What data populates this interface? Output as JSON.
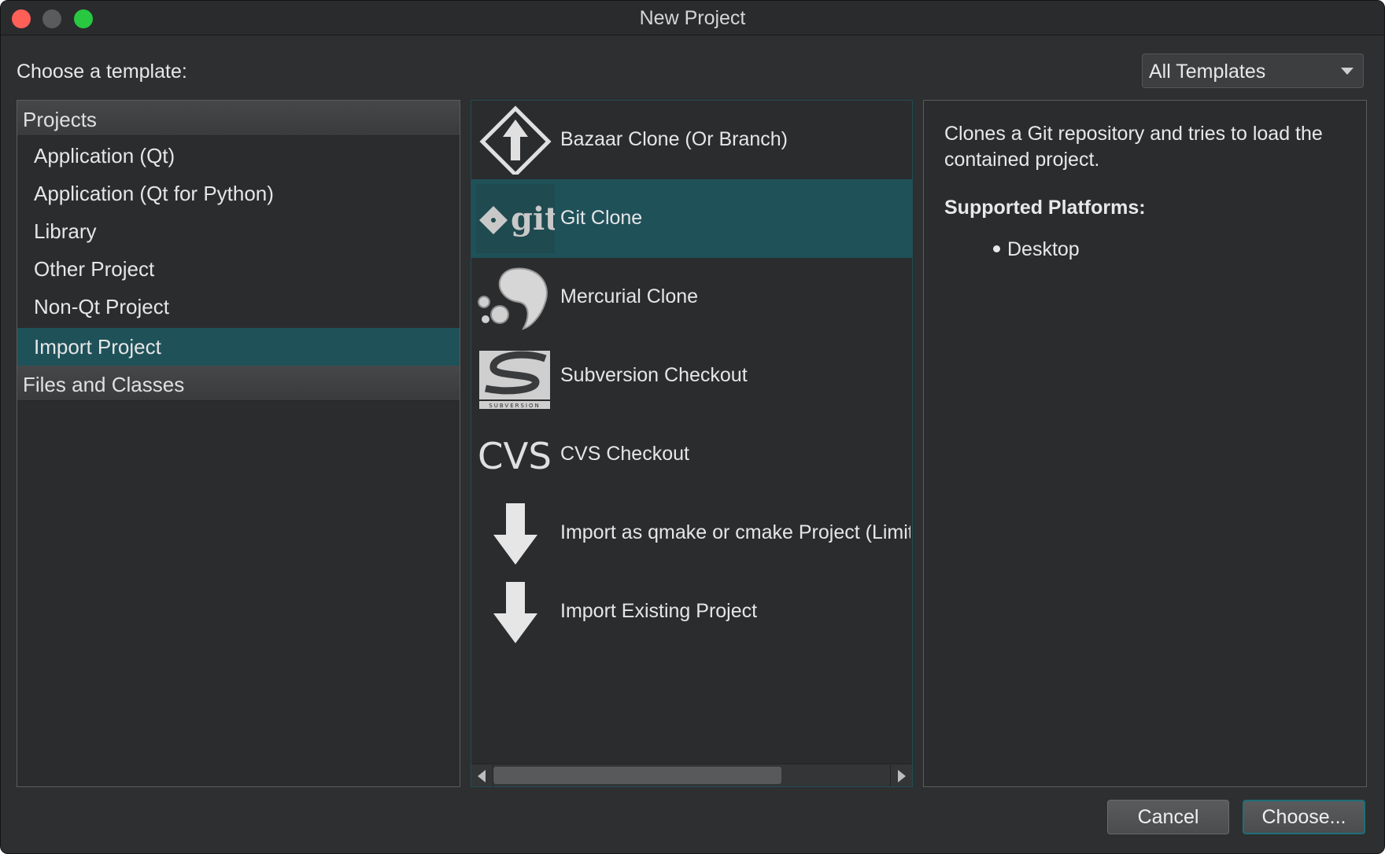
{
  "window": {
    "title": "New Project"
  },
  "header": {
    "prompt": "Choose a template:",
    "filter_selected": "All Templates"
  },
  "categories": {
    "groups": [
      {
        "label": "Projects"
      },
      {
        "label": "Files and Classes"
      }
    ],
    "items": [
      {
        "label": "Application (Qt)"
      },
      {
        "label": "Application (Qt for Python)"
      },
      {
        "label": "Library"
      },
      {
        "label": "Other Project"
      },
      {
        "label": "Non-Qt Project"
      },
      {
        "label": "Import Project",
        "selected": true
      }
    ]
  },
  "templates": [
    {
      "label": "Bazaar Clone (Or Branch)",
      "icon": "bazaar-icon"
    },
    {
      "label": "Git Clone",
      "icon": "git-icon",
      "selected": true
    },
    {
      "label": "Mercurial Clone",
      "icon": "mercurial-icon"
    },
    {
      "label": "Subversion Checkout",
      "icon": "subversion-icon"
    },
    {
      "label": "CVS Checkout",
      "icon": "cvs-icon"
    },
    {
      "label": "Import as qmake or cmake Project (Limited Functionality)",
      "icon": "down-arrow-icon"
    },
    {
      "label": "Import Existing Project",
      "icon": "down-arrow-icon"
    }
  ],
  "icon_text": {
    "git": "git",
    "cvs": "CVS",
    "subversion": "SUBVERSION"
  },
  "details": {
    "description": "Clones a Git repository and tries to load the contained project.",
    "platforms_title": "Supported Platforms:",
    "platforms": [
      "Desktop"
    ]
  },
  "buttons": {
    "cancel": "Cancel",
    "choose": "Choose..."
  },
  "colors": {
    "selection": "#1f5159",
    "window_bg": "#2e2f31",
    "close": "#fe5f57",
    "maximize": "#28c840"
  }
}
